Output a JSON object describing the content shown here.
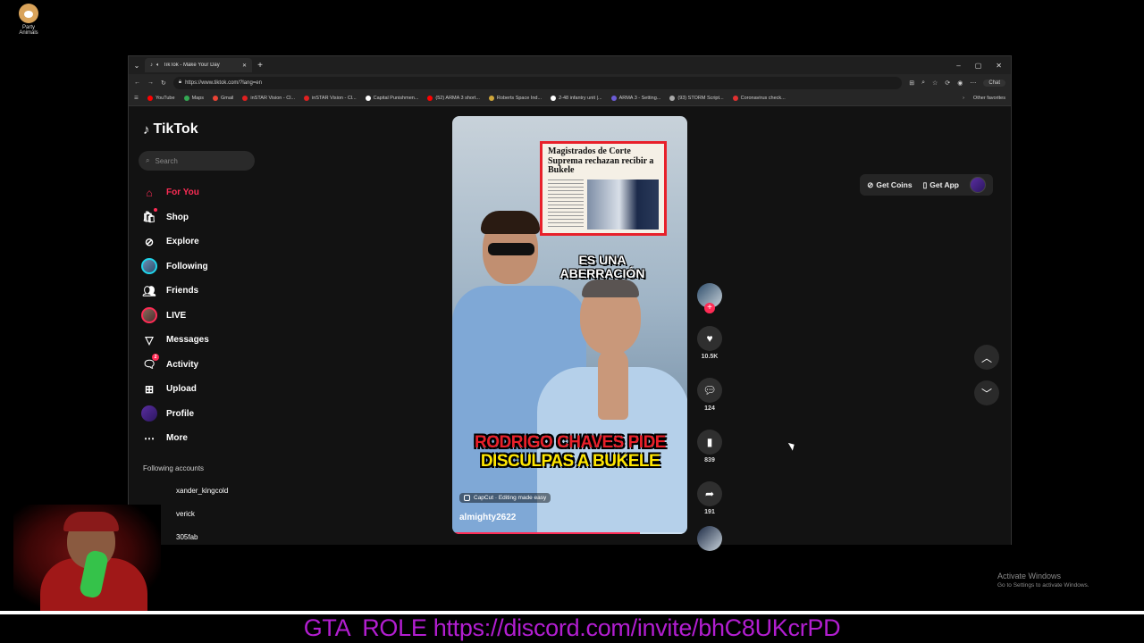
{
  "desktop": {
    "icon_label": "Party\nAnimals",
    "watermark_line1": "Activate Windows",
    "watermark_line2": "Go to Settings to activate Windows.",
    "banner_text": "GTA  ROLE https://discord.com/invite/bhC8UKcrPD"
  },
  "browser": {
    "tab_title": "TikTok - Make Your Day",
    "url": "https://www.tiktok.com/?lang=en",
    "chat_label": "Chat",
    "bookmarks": [
      {
        "label": "YouTube",
        "color": "#ff0000"
      },
      {
        "label": "Maps",
        "color": "#34a853"
      },
      {
        "label": "Gmail",
        "color": "#ea4335"
      },
      {
        "label": "inSTAR Vision - Cl...",
        "color": "#e02020"
      },
      {
        "label": "inSTAR Vision - Cl...",
        "color": "#e02020"
      },
      {
        "label": "Capital Punishmen...",
        "color": "#ffffff"
      },
      {
        "label": "(52) ARMA 3 short...",
        "color": "#ff0000"
      },
      {
        "label": "Roberts Space Ind...",
        "color": "#cfa63a"
      },
      {
        "label": "2-48 infantry unit |...",
        "color": "#ffffff"
      },
      {
        "label": "ARMA 3 - Setting...",
        "color": "#6b5cd6"
      },
      {
        "label": "(93) STORM Script...",
        "color": "#aaaaaa"
      },
      {
        "label": "Coronavirus check...",
        "color": "#e03030"
      }
    ],
    "other_favorites": "Other favorites"
  },
  "tiktok": {
    "logo": "TikTok",
    "search_placeholder": "Search",
    "nav": [
      {
        "label": "For You",
        "icon": "home-icon"
      },
      {
        "label": "Shop",
        "icon": "shop-icon"
      },
      {
        "label": "Explore",
        "icon": "compass-icon"
      },
      {
        "label": "Following",
        "icon": "following-avatar"
      },
      {
        "label": "Friends",
        "icon": "friends-icon"
      },
      {
        "label": "LIVE",
        "icon": "live-avatar"
      },
      {
        "label": "Messages",
        "icon": "messages-icon"
      },
      {
        "label": "Activity",
        "icon": "activity-icon",
        "badge": "2"
      },
      {
        "label": "Upload",
        "icon": "upload-icon"
      },
      {
        "label": "Profile",
        "icon": "profile-avatar"
      },
      {
        "label": "More",
        "icon": "more-icon"
      }
    ],
    "following_accounts_heading": "Following accounts",
    "following_accounts": [
      "xander_kingcold",
      "verick",
      "305fab"
    ],
    "get_coins": "Get Coins",
    "get_app": "Get App",
    "accent_color": "#fe2c55",
    "video": {
      "newspaper_headline": "Magistrados de Corte Suprema rechazan recibir a Bukele",
      "overlay_text": "ES UNA ABERRACIÓN",
      "caption_line1": "RODRIGO CHAVES PIDE",
      "caption_line2": "DISCULPAS A BUKELE",
      "capcut_label": "CapCut · Editing made easy",
      "author": "almighty2622",
      "progress": 0.8
    },
    "actions": {
      "likes": "10.5K",
      "comments": "124",
      "saves": "839",
      "shares": "191"
    }
  }
}
